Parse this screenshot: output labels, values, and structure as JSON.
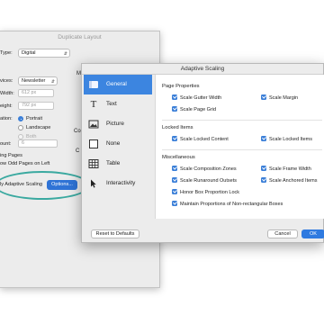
{
  "back_dialog": {
    "title": "Duplicate Layout",
    "type_label": "Type:",
    "type_value": "Digital",
    "devices_label": "vices:",
    "devices_value": "Newsletter",
    "width_label": "Width:",
    "width_value": "612 px",
    "height_label": "eight:",
    "height_value": "792 px",
    "orientation_label": "ation:",
    "portrait": "Portrait",
    "landscape": "Landscape",
    "both": "Both",
    "count_label": "ount:",
    "count_value": "6",
    "facing_pages": "ing Pages",
    "odd_pages": "ow Odd Pages on Left",
    "side_letter_m": "M",
    "side_letter_co": "Co",
    "side_letter_c": "C",
    "adaptive_scaling_label": "ly Adaptive Scaling",
    "options_button": "Options..."
  },
  "adaptive_scaling": {
    "title": "Adaptive Scaling",
    "sidebar": [
      {
        "label": "General",
        "icon": "general-icon",
        "selected": true
      },
      {
        "label": "Text",
        "icon": "text-icon",
        "selected": false
      },
      {
        "label": "Picture",
        "icon": "picture-icon",
        "selected": false
      },
      {
        "label": "None",
        "icon": "none-icon",
        "selected": false
      },
      {
        "label": "Table",
        "icon": "table-icon",
        "selected": false
      },
      {
        "label": "Interactivity",
        "icon": "interactivity-icon",
        "selected": false
      }
    ],
    "page_properties": {
      "heading": "Page Properties",
      "scale_gutter_width": "Scale Gutter Width",
      "scale_margin": "Scale Margin",
      "scale_page_grid": "Scale Page Grid"
    },
    "locked_items": {
      "heading": "Locked Items",
      "scale_locked_content": "Scale Locked Content",
      "scale_locked_items": "Scale Locked Items"
    },
    "miscellaneous": {
      "heading": "Miscellaneous",
      "scale_composition_zones": "Scale Composition Zones",
      "scale_frame_width": "Scale Frame Width",
      "scale_runaround_outsets": "Scale Runaround Outsets",
      "scale_anchored_items": "Scale Anchored Items",
      "honor_box_proportion_lock": "Honor Box Proportion Lock",
      "maintain_proportions": "Maintain Proportions of Non-rectangular Boxes"
    },
    "reset_button": "Reset to Defaults",
    "cancel_button": "Cancel",
    "ok_button": "OK"
  },
  "colors": {
    "accent": "#3c85e0",
    "highlight_oval": "#3aa9a0"
  }
}
